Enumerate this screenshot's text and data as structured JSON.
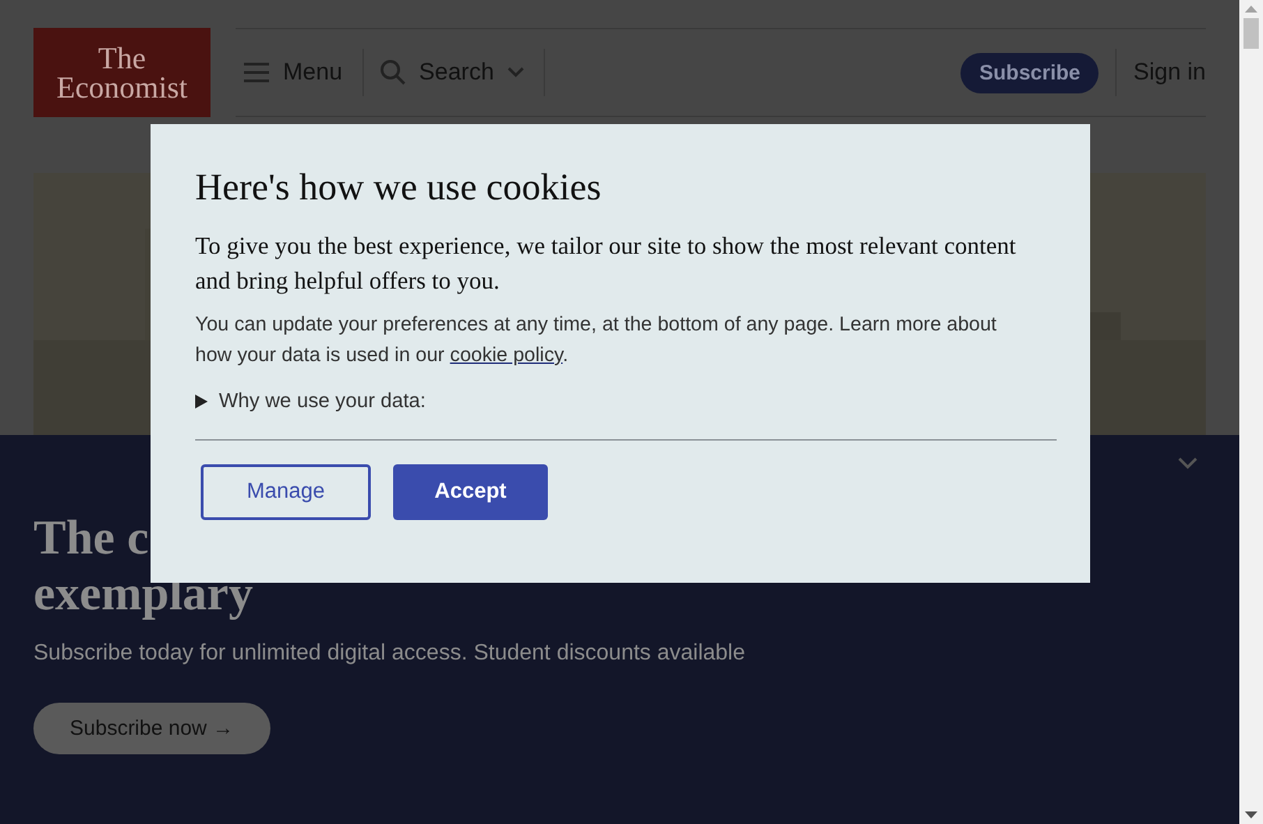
{
  "header": {
    "logo": [
      "The",
      "Economist"
    ],
    "menu": "Menu",
    "search": "Search",
    "subscribe": "Subscribe",
    "sign_in": "Sign in"
  },
  "banner": {
    "heading": [
      "The c",
      "exemplary"
    ],
    "subtitle": "Subscribe today for unlimited digital access. Student discounts available",
    "button": "Subscribe now →"
  },
  "dialog": {
    "title": "Here's how we use cookies",
    "lead": "To give you the best experience, we tailor our site to show the most relevant content and bring helpful offers to you.",
    "body": "You can update your preferences at any time, at the bottom of any page. Learn more about how your data is used in our ",
    "link": "cookie policy",
    "body_end": ".",
    "disclosure": {
      "label": "Why we use your data:",
      "expanded": false
    },
    "buttons": [
      {
        "label": "Manage",
        "kind": "secondary"
      },
      {
        "label": "Accept",
        "kind": "primary"
      }
    ]
  }
}
